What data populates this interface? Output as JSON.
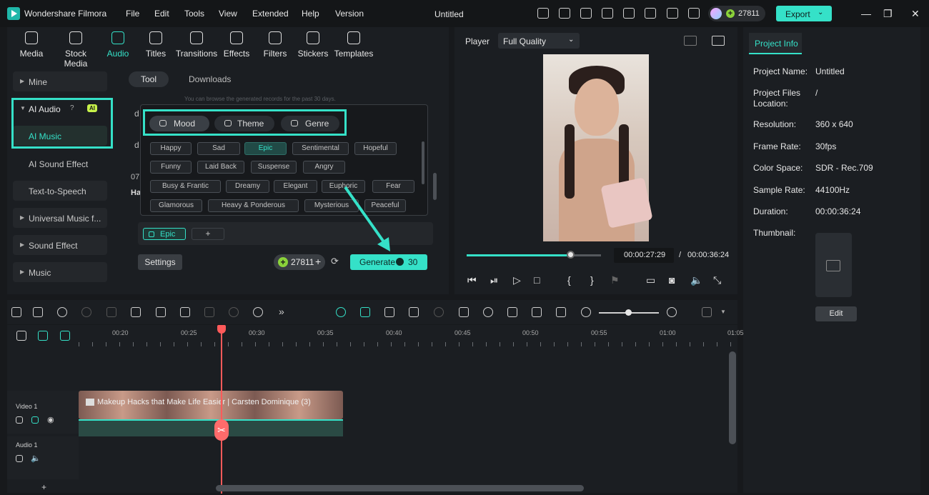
{
  "titlebar": {
    "app_name": "Wondershare Filmora",
    "menus": [
      "File",
      "Edit",
      "Tools",
      "View",
      "Extended",
      "Help",
      "Version"
    ],
    "doc_title": "Untitled",
    "credits": "27811",
    "export_label": "Export"
  },
  "media_tabs": [
    {
      "label": "Media",
      "icon": "media-icon"
    },
    {
      "label": "Stock Media",
      "icon": "stock-media-icon"
    },
    {
      "label": "Audio",
      "icon": "audio-icon",
      "active": true
    },
    {
      "label": "Titles",
      "icon": "titles-icon"
    },
    {
      "label": "Transitions",
      "icon": "transitions-icon"
    },
    {
      "label": "Effects",
      "icon": "effects-icon"
    },
    {
      "label": "Filters",
      "icon": "filters-icon"
    },
    {
      "label": "Stickers",
      "icon": "stickers-icon"
    },
    {
      "label": "Templates",
      "icon": "templates-icon"
    }
  ],
  "sidebar": {
    "mine": "Mine",
    "ai_audio": "AI Audio",
    "ai_badge": "AI",
    "ai_music": "AI Music",
    "ai_sound_effect": "AI Sound Effect",
    "tts": "Text-to-Speech",
    "universal": "Universal Music f...",
    "sound_effect": "Sound Effect",
    "music": "Music"
  },
  "panel": {
    "tab_tool": "Tool",
    "tab_downloads": "Downloads",
    "hint": "You can browse the generated records for the past 30 days.",
    "partial_1": "d",
    "partial_2": "d",
    "partial_3": "07",
    "partial_4": "Ha"
  },
  "popup": {
    "mood": "Mood",
    "theme": "Theme",
    "genre": "Genre",
    "chips": [
      "Happy",
      "Sad",
      "Epic",
      "Sentimental",
      "Hopeful",
      "Funny",
      "Laid Back",
      "Suspense",
      "Angry",
      "Busy & Frantic",
      "Dreamy",
      "Elegant",
      "Euphoric",
      "Fear",
      "Glamorous",
      "Heavy & Ponderous",
      "Mysterious",
      "Peaceful"
    ],
    "active_chip": "Epic"
  },
  "selection": {
    "selected_tag": "Epic",
    "add": "+"
  },
  "actions": {
    "settings": "Settings",
    "credits": "27811",
    "generate": "Generate",
    "generate_cost": "30"
  },
  "player": {
    "label": "Player",
    "quality": "Full Quality",
    "current_time": "00:00:27:29",
    "separator": "/",
    "total_time": "00:00:36:24",
    "progress": 0.77
  },
  "project_info": {
    "tab": "Project Info",
    "rows": [
      {
        "label": "Project Name:",
        "value": "Untitled"
      },
      {
        "label": "Project Files Location:",
        "value": "/"
      },
      {
        "label": "Resolution:",
        "value": "360 x 640"
      },
      {
        "label": "Frame Rate:",
        "value": "30fps"
      },
      {
        "label": "Color Space:",
        "value": "SDR - Rec.709"
      },
      {
        "label": "Sample Rate:",
        "value": "44100Hz"
      },
      {
        "label": "Duration:",
        "value": "00:00:36:24"
      },
      {
        "label": "Thumbnail:",
        "value": ""
      }
    ],
    "edit": "Edit"
  },
  "ruler": [
    "00:20",
    "00:25",
    "00:30",
    "00:35",
    "00:40",
    "00:45",
    "00:50",
    "00:55",
    "01:00",
    "01:05"
  ],
  "tracks": {
    "video_label": "Video 1",
    "audio_label": "Audio 1",
    "clip_title": "Makeup Hacks that Make Life Easier | Carsten Dominique (3)",
    "add": "+"
  },
  "colors": {
    "accent": "#35e1c8",
    "playhead": "#ff5a5a"
  }
}
